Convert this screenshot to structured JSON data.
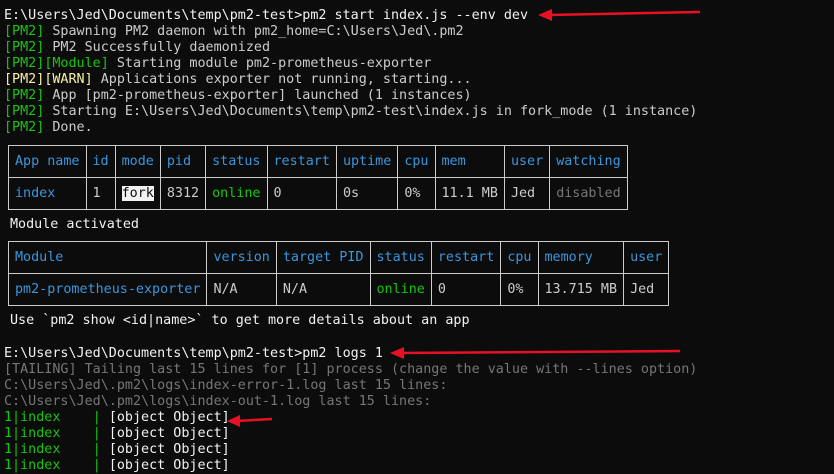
{
  "lines": {
    "cmd1": "E:\\Users\\Jed\\Documents\\temp\\pm2-test>pm2 start index.js --env dev",
    "l1_tag": "[PM2]",
    "l1_text": " Spawning PM2 daemon with pm2_home=C:\\Users\\Jed\\.pm2",
    "l2_tag": "[PM2]",
    "l2_text": " PM2 Successfully daemonized",
    "l3_tag": "[PM2]",
    "l3_tag2": "[Module]",
    "l3_text": " Starting module pm2-prometheus-exporter",
    "l4_tag": "[PM2]",
    "l4_tag2": "[WARN]",
    "l4_text": " Applications exporter not running, starting...",
    "l5_tag": "[PM2]",
    "l5_text": " App [pm2-prometheus-exporter] launched (1 instances)",
    "l6_tag": "[PM2]",
    "l6_text": " Starting E:\\Users\\Jed\\Documents\\temp\\pm2-test\\index.js in fork_mode (1 instance)",
    "l7_tag": "[PM2]",
    "l7_text": " Done.",
    "module_activated": "Module activated",
    "hint": "Use `pm2 show <id|name>` to get more details about an app",
    "cmd2": "E:\\Users\\Jed\\Documents\\temp\\pm2-test>pm2 logs 1",
    "tailing": "[TAILING] Tailing last 15 lines for [1] process (change the value with --lines option)",
    "err_log": "C:\\Users\\Jed\\.pm2\\logs\\index-error-1.log last 15 lines:",
    "out_log": "C:\\Users\\Jed\\.pm2\\logs\\index-out-1.log last 15 lines:"
  },
  "apps_table": {
    "headers": [
      "App name",
      "id",
      "mode",
      "pid",
      "status",
      "restart",
      "uptime",
      "cpu",
      "mem",
      "user",
      "watching"
    ],
    "row": [
      "index",
      "1",
      "fork",
      "8312",
      "online",
      "0",
      "0s",
      "0%",
      "11.1 MB",
      "Jed",
      "disabled"
    ]
  },
  "modules_table": {
    "headers": [
      "Module",
      "version",
      "target PID",
      "status",
      "restart",
      "cpu",
      "memory",
      "user"
    ],
    "row": [
      "pm2-prometheus-exporter",
      "N/A",
      "N/A",
      "online",
      "0",
      "0%",
      "13.715 MB",
      "Jed"
    ]
  },
  "log_lines": [
    {
      "prefix": "1|index    ",
      "sep": "| ",
      "msg": "[object Object]"
    },
    {
      "prefix": "1|index    ",
      "sep": "| ",
      "msg": "[object Object]"
    },
    {
      "prefix": "1|index    ",
      "sep": "| ",
      "msg": "[object Object]"
    },
    {
      "prefix": "1|index    ",
      "sep": "| ",
      "msg": "[object Object]"
    }
  ],
  "colors": {
    "background": "#0c0c0c",
    "text": "#cccccc",
    "green": "#16c60c",
    "yellow": "#f9f1a5",
    "header_blue": "#3a96dd",
    "dim": "#767676",
    "arrow_red": "#e81123"
  }
}
